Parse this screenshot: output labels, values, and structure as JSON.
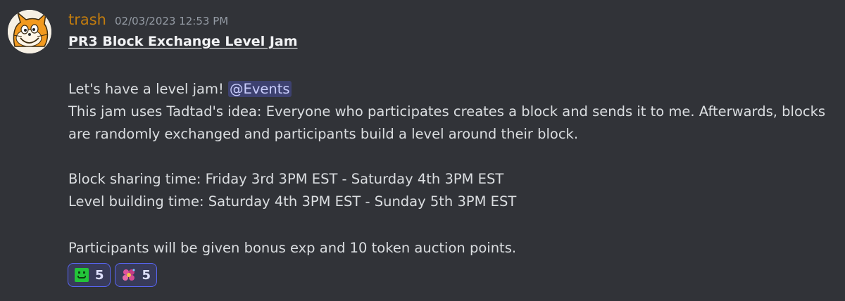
{
  "author": {
    "username": "trash",
    "timestamp": "02/03/2023 12:53 PM"
  },
  "message": {
    "title": "PR3 Block Exchange Level Jam",
    "intro_text": "Let's have a level jam!",
    "mention": "@Events",
    "body_line_1": "This jam uses Tadtad's idea: Everyone who participates creates a block and sends it to me. Afterwards, blocks",
    "body_line_2": "are randomly exchanged and participants build a level around their block.",
    "schedule_1": "Block sharing time: Friday 3rd 3PM EST - Saturday 4th 3PM EST",
    "schedule_2": "Level building time: Saturday 4th 3PM EST - Sunday 5th 3PM EST",
    "rewards": "Participants will be given bonus exp and 10 token auction points."
  },
  "reactions": [
    {
      "emoji": "green-smile-emoji",
      "count": "5"
    },
    {
      "emoji": "pink-flower-emoji",
      "count": "5"
    }
  ],
  "colors": {
    "background": "#313338",
    "username": "#c27c0e",
    "mention_bg": "#3c4270",
    "reaction_border": "#5865f2"
  }
}
